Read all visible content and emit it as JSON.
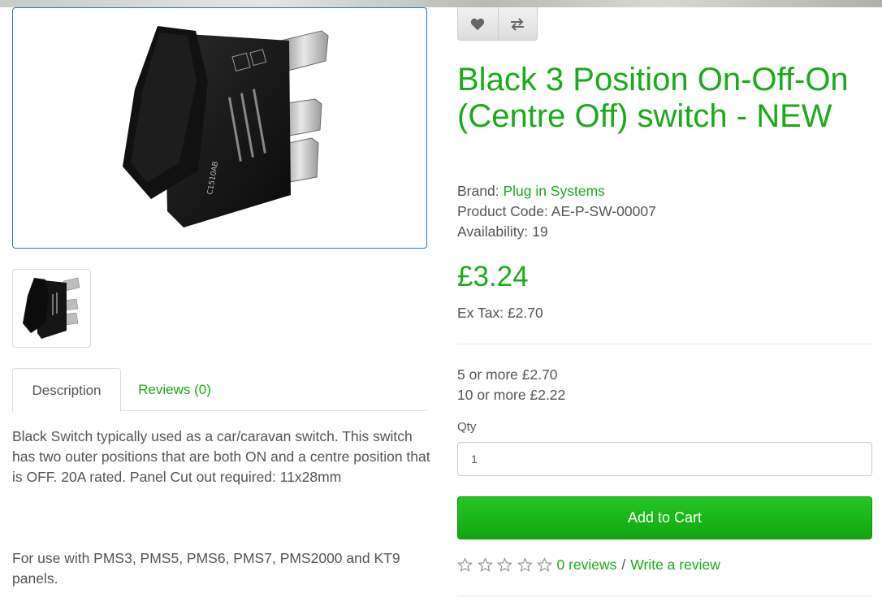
{
  "product": {
    "title": "Black 3 Position On-Off-On (Centre Off) switch - NEW",
    "brand_label": "Brand:",
    "brand_value": "Plug in Systems",
    "code_label": "Product Code:",
    "code_value": "AE-P-SW-00007",
    "availability_label": "Availability:",
    "availability_value": "19",
    "price": "£3.24",
    "ex_tax": "Ex Tax: £2.70",
    "discounts": [
      "5 or more £2.70",
      "10 or more £2.22"
    ],
    "switch_print": "C1510AB"
  },
  "actions": {
    "wishlist_icon": "heart-icon",
    "compare_icon": "compare-arrows-icon"
  },
  "tabs": [
    {
      "label": "Description",
      "active": true
    },
    {
      "label": "Reviews (0)",
      "active": false
    }
  ],
  "description": {
    "paragraph1": "Black Switch typically used as a car/caravan switch. This switch has two outer positions that are both ON and a centre position that is OFF.  20A rated. Panel Cut out required: 11x28mm",
    "paragraph2": "For use with PMS3, PMS5, PMS6, PMS7, PMS2000 and KT9 panels."
  },
  "cart": {
    "qty_label": "Qty",
    "qty_value": "1",
    "add_to_cart_label": "Add to Cart"
  },
  "reviews": {
    "stars_filled": 0,
    "stars_total": 5,
    "count_link": "0 reviews",
    "separator": "/",
    "write_link": "Write a review"
  },
  "colors": {
    "accent_green": "#1aaa1a",
    "button_green": "#18b818",
    "image_border_blue": "#2a7bbd",
    "text_gray": "#555555"
  }
}
